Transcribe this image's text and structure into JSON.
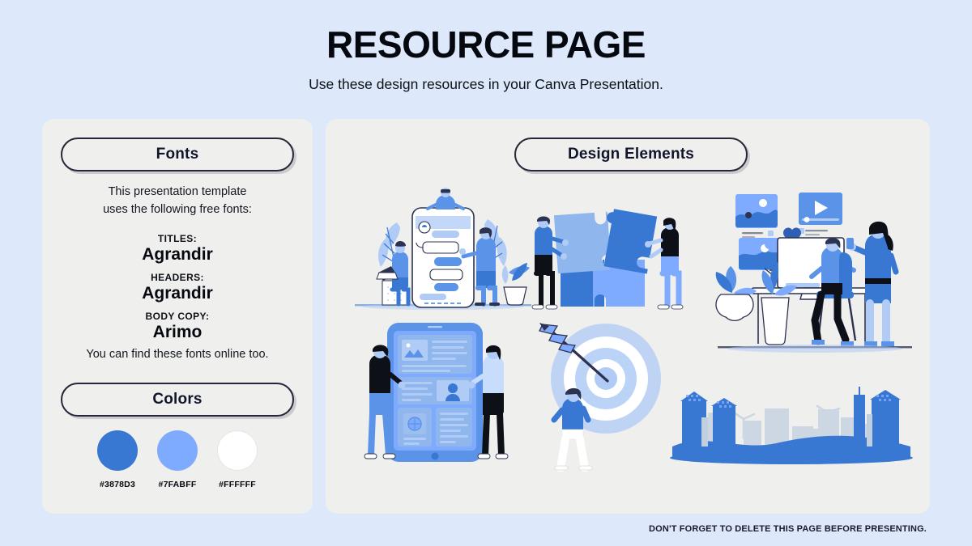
{
  "header": {
    "title": "RESOURCE PAGE",
    "subtitle": "Use these design resources in your Canva Presentation."
  },
  "fonts_panel": {
    "pill_label": "Fonts",
    "intro": "This presentation template\nuses the following free fonts:",
    "groups": [
      {
        "role": "TITLES:",
        "name": "Agrandir"
      },
      {
        "role": "HEADERS:",
        "name": "Agrandir"
      },
      {
        "role": "BODY COPY:",
        "name": "Arimo"
      }
    ],
    "outro": "You can find these fonts online too."
  },
  "colors_panel": {
    "pill_label": "Colors",
    "swatches": [
      {
        "hex": "#3878D3",
        "label": "#3878D3"
      },
      {
        "hex": "#7FABFF",
        "label": "#7FABFF"
      },
      {
        "hex": "#FFFFFF",
        "label": "#FFFFFF"
      }
    ]
  },
  "design_panel": {
    "pill_label": "Design Elements",
    "illustrations": [
      {
        "name": "chat-app-illustration",
        "alt": "People around a large smartphone with chat bubbles and plants"
      },
      {
        "name": "puzzle-illustration",
        "alt": "Two people assembling a four-piece jigsaw puzzle"
      },
      {
        "name": "office-desk-illustration",
        "alt": "Person at a desk with monitor and a woman with a phone, media cards and plants"
      },
      {
        "name": "tablet-ui-illustration",
        "alt": "Two people beside a large tablet showing wireframe content blocks"
      },
      {
        "name": "target-arrow-illustration",
        "alt": "Person looking at a target hit by an arrow near the bullseye"
      },
      {
        "name": "city-skyline-illustration",
        "alt": "Blue city skyline with buildings and wind turbines"
      }
    ]
  },
  "footer": {
    "note": "DON'T FORGET TO DELETE THIS PAGE BEFORE PRESENTING."
  },
  "palette": {
    "background": "#DDE8FB",
    "panel": "#EFEFED",
    "ink": "#11152B",
    "blue_dark": "#3878D3",
    "blue_mid": "#5B93E8",
    "blue_light": "#7FABFF",
    "blue_pale": "#AFCBF6",
    "white": "#FFFFFF"
  }
}
